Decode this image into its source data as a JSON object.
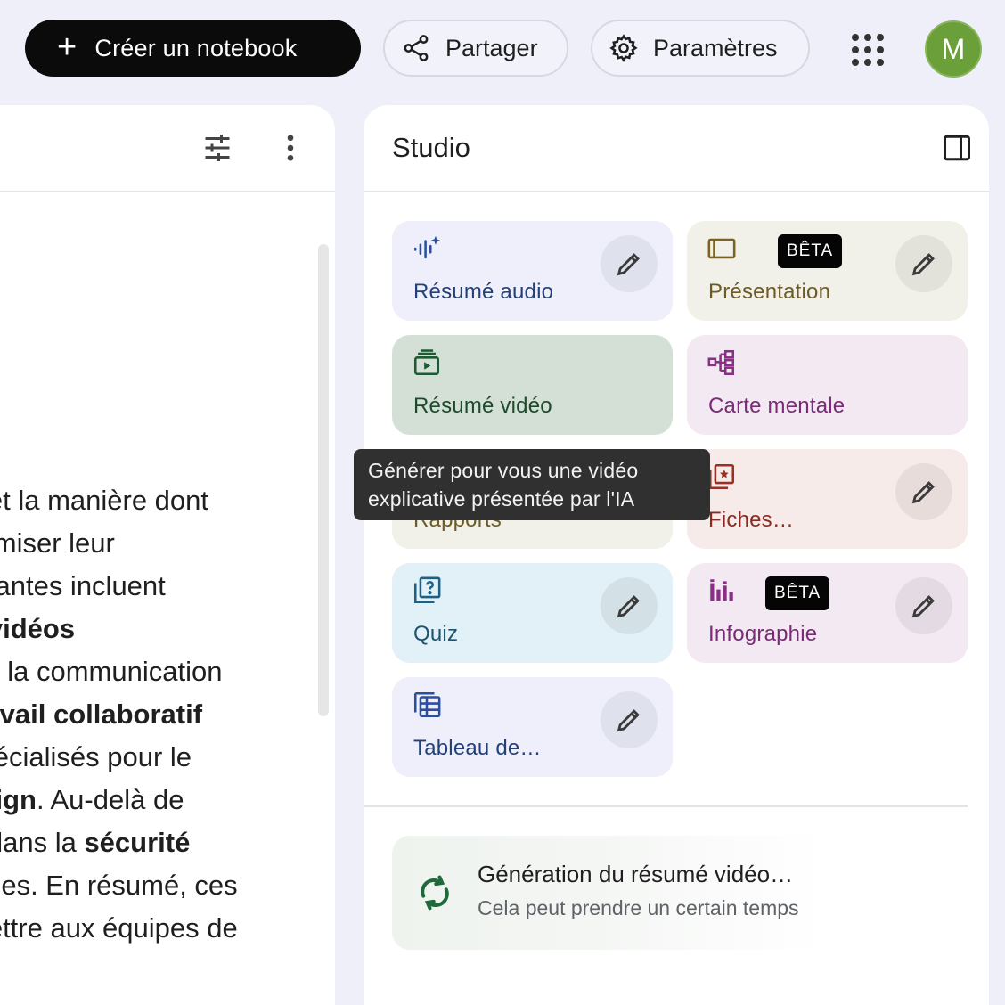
{
  "topbar": {
    "create_label": "Créer un notebook",
    "share_label": "Partager",
    "settings_label": "Paramètres",
    "avatar_letter": "M"
  },
  "left_panel": {
    "lines": [
      [
        {
          "t": "e",
          "b": true
        },
        {
          "t": " et la manière dont",
          "b": false
        }
      ],
      [
        {
          "t": "ptimiser leur",
          "b": false
        }
      ],
      [
        {
          "t": "quantes incluent",
          "b": false
        }
      ],
      [
        {
          "t": "n ",
          "b": false
        },
        {
          "t": "vidéos",
          "b": true
        }
      ],
      [
        {
          "t": "nsi la communication",
          "b": false
        }
      ],
      [
        {
          "t": " ",
          "b": false
        },
        {
          "t": "travail collaboratif",
          "b": true
        }
      ],
      [
        {
          "t": " spécialisés pour le",
          "b": false
        }
      ],
      [
        {
          "t": "esign",
          "b": true
        },
        {
          "t": ". Au-delà de",
          "b": false
        }
      ],
      [
        {
          "t": "e dans la ",
          "b": false
        },
        {
          "t": "sécurité",
          "b": true
        }
      ],
      [
        {
          "t": "relles. En résumé, ces",
          "b": false
        }
      ],
      [
        {
          "t": "mettre aux équipes de",
          "b": false
        }
      ]
    ]
  },
  "studio": {
    "title": "Studio",
    "cards": {
      "audio": {
        "label": "Résumé audio",
        "icon": "audio-spark-icon"
      },
      "presentation": {
        "label": "Présentation",
        "badge": "BÊTA",
        "icon": "slides-icon"
      },
      "video": {
        "label": "Résumé vidéo",
        "icon": "video-icon"
      },
      "mindmap": {
        "label": "Carte mentale",
        "icon": "mindmap-icon"
      },
      "reports": {
        "label": "Rapports",
        "icon": "report-icon"
      },
      "flashcards": {
        "label": "Fiches…",
        "icon": "flashcards-icon"
      },
      "quiz": {
        "label": "Quiz",
        "icon": "quiz-icon"
      },
      "infographic": {
        "label": "Infographie",
        "badge": "BÊTA",
        "icon": "chart-icon"
      },
      "table": {
        "label": "Tableau de…",
        "icon": "table-icon"
      }
    },
    "progress": {
      "title": "Génération du résumé vidéo…",
      "subtitle": "Cela peut prendre un certain temps"
    }
  },
  "tooltip": {
    "line1": "Générer pour vous une vidéo",
    "line2": "explicative présentée par l'IA"
  },
  "colors": {
    "background": "#eeeff8",
    "create_button": "#0b0b0b",
    "avatar": "#6a9f3a",
    "tooltip": "#303030"
  }
}
